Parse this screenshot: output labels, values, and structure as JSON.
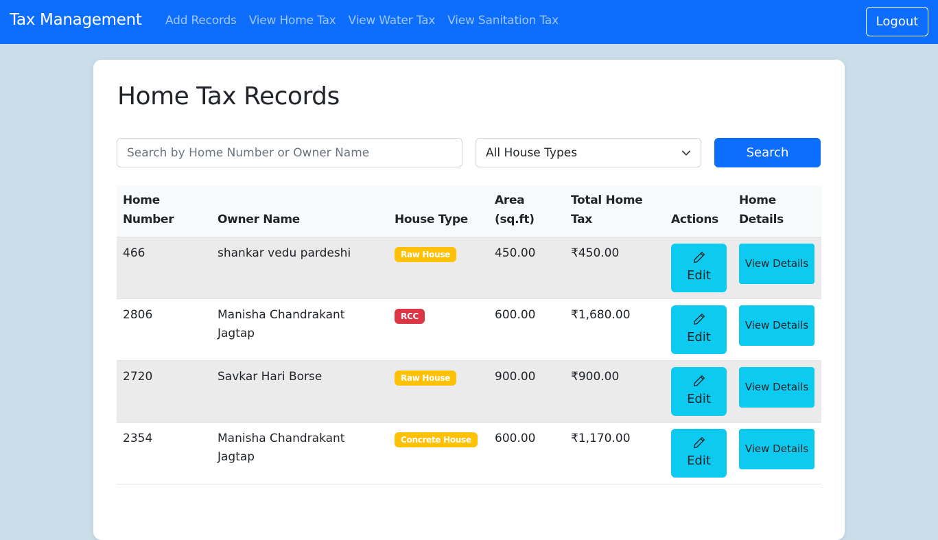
{
  "navbar": {
    "brand": "Tax Management",
    "links": [
      "Add Records",
      "View Home Tax",
      "View Water Tax",
      "View Sanitation Tax"
    ],
    "logout": "Logout"
  },
  "page": {
    "title": "Home Tax Records",
    "search_placeholder": "Search by Home Number or Owner Name",
    "search_value": "",
    "house_type_selected": "All House Types",
    "search_button": "Search"
  },
  "table": {
    "headers": [
      "Home Number",
      "Owner Name",
      "House Type",
      "Area (sq.ft)",
      "Total Home Tax",
      "Actions",
      "Home Details"
    ],
    "edit_label": "Edit",
    "view_label": "View Details",
    "rows": [
      {
        "home_number": "466",
        "owner": "shankar vedu pardeshi",
        "house_type": "Raw House",
        "badge_color": "#ffc107",
        "area": "450.00",
        "tax": "₹450.00"
      },
      {
        "home_number": "2806",
        "owner": "Manisha Chandrakant Jagtap",
        "house_type": "RCC",
        "badge_color": "#dc3545",
        "area": "600.00",
        "tax": "₹1,680.00"
      },
      {
        "home_number": "2720",
        "owner": "Savkar Hari Borse",
        "house_type": "Raw House",
        "badge_color": "#ffc107",
        "area": "900.00",
        "tax": "₹900.00"
      },
      {
        "home_number": "2354",
        "owner": "Manisha Chandrakant Jagtap",
        "house_type": "Concrete House",
        "badge_color": "#ffc107",
        "area": "600.00",
        "tax": "₹1,170.00"
      }
    ]
  },
  "colors": {
    "primary": "#0d6efd",
    "info": "#0dcaf0",
    "warning": "#ffc107",
    "danger": "#dc3545",
    "background": "#cbdde8"
  }
}
